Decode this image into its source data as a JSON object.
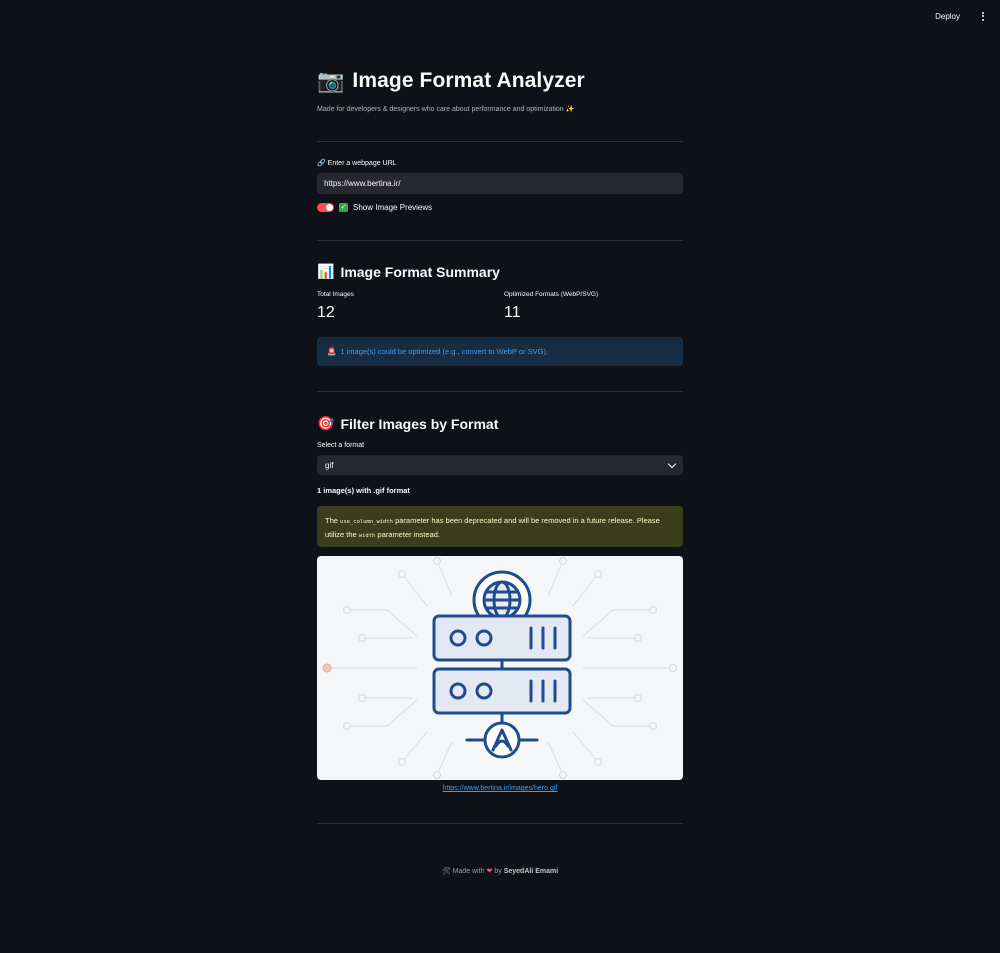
{
  "header": {
    "deploy_label": "Deploy"
  },
  "app": {
    "title_emoji": "📷",
    "title": "Image Format Analyzer",
    "subtitle": "Made for developers & designers who care about performance and optimization ✨"
  },
  "url_field": {
    "label_icon": "🔗",
    "label": "Enter a webpage URL",
    "value": "https://www.bertina.ir/"
  },
  "preview_toggle": {
    "checked": true,
    "label": "Show Image Previews"
  },
  "summary": {
    "emoji": "📊",
    "title": "Image Format Summary",
    "metrics": [
      {
        "label": "Total Images",
        "value": "12"
      },
      {
        "label": "Optimized Formats (WebP/SVG)",
        "value": "11"
      }
    ],
    "info_icon": "🚨",
    "info_text": "1 image(s) could be optimized (e.g., convert to WebP or SVG)."
  },
  "filter": {
    "emoji": "🎯",
    "title": "Filter Images by Format",
    "select_label": "Select a format",
    "selected": "gif",
    "count_text": "1 image(s) with .gif format",
    "warning": {
      "prefix": "The ",
      "code1": "use_column_width",
      "middle": " parameter has been deprecated and will be removed in a future release. Please utilize the ",
      "code2": "width",
      "suffix": " parameter instead."
    },
    "image_link": "https://www.bertina.ir/images/hero.gif"
  },
  "footer": {
    "icon": "🛠",
    "prefix": "Made with",
    "heart": "❤",
    "by": "by",
    "author": "SeyedAli Emami"
  },
  "colors": {
    "background": "#0e1117",
    "accent": "#ff4b4b",
    "info_bg": "#172d43",
    "info_text": "#3d9df3",
    "warning_bg": "#3a3e1c",
    "warning_text": "#fdfdc6",
    "illustration_blue": "#1f4c8f"
  }
}
